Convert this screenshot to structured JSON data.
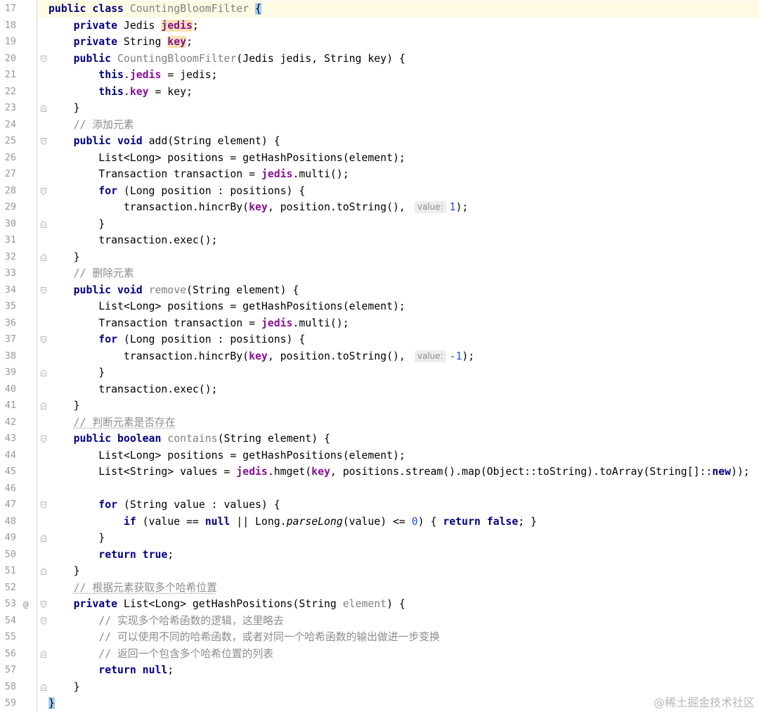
{
  "editor": {
    "lines": [
      {
        "n": "17",
        "current": true,
        "tok": [
          [
            "keyword",
            "public"
          ],
          [
            "plain",
            " "
          ],
          [
            "keyword",
            "class"
          ],
          [
            "plain",
            " "
          ],
          [
            "unused",
            "CountingBloomFilter"
          ],
          [
            "plain",
            " "
          ],
          [
            "brace-match",
            "{"
          ]
        ]
      },
      {
        "n": "18",
        "tok": [
          [
            "plain",
            "    "
          ],
          [
            "keyword",
            "private"
          ],
          [
            "plain",
            " Jedis "
          ],
          [
            "usage-highlight",
            "jedis"
          ],
          [
            "plain",
            ";"
          ]
        ]
      },
      {
        "n": "19",
        "tok": [
          [
            "plain",
            "    "
          ],
          [
            "keyword",
            "private"
          ],
          [
            "plain",
            " String "
          ],
          [
            "usage-highlight",
            "key"
          ],
          [
            "plain",
            ";"
          ]
        ]
      },
      {
        "n": "20",
        "fold": "fold-start-icon",
        "tok": [
          [
            "plain",
            "    "
          ],
          [
            "keyword",
            "public"
          ],
          [
            "plain",
            " "
          ],
          [
            "unused",
            "CountingBloomFilter"
          ],
          [
            "plain",
            "(Jedis jedis, String key) {"
          ]
        ]
      },
      {
        "n": "21",
        "tok": [
          [
            "plain",
            "        "
          ],
          [
            "keyword",
            "this"
          ],
          [
            "plain",
            "."
          ],
          [
            "field",
            "jedis"
          ],
          [
            "plain",
            " = jedis;"
          ]
        ]
      },
      {
        "n": "22",
        "tok": [
          [
            "plain",
            "        "
          ],
          [
            "keyword",
            "this"
          ],
          [
            "plain",
            "."
          ],
          [
            "field",
            "key"
          ],
          [
            "plain",
            " = key;"
          ]
        ]
      },
      {
        "n": "23",
        "fold": "fold-end-icon",
        "tok": [
          [
            "plain",
            "    }"
          ]
        ]
      },
      {
        "n": "24",
        "tok": [
          [
            "plain",
            "    "
          ],
          [
            "comment",
            "// 添加元素"
          ]
        ]
      },
      {
        "n": "25",
        "fold": "fold-start-icon",
        "tok": [
          [
            "plain",
            "    "
          ],
          [
            "keyword",
            "public"
          ],
          [
            "plain",
            " "
          ],
          [
            "keyword",
            "void"
          ],
          [
            "plain",
            " add(String element) {"
          ]
        ]
      },
      {
        "n": "26",
        "tok": [
          [
            "plain",
            "        List<Long> positions = getHashPositions(element);"
          ]
        ]
      },
      {
        "n": "27",
        "tok": [
          [
            "plain",
            "        Transaction transaction = "
          ],
          [
            "field",
            "jedis"
          ],
          [
            "plain",
            ".multi();"
          ]
        ]
      },
      {
        "n": "28",
        "fold": "fold-start-icon",
        "tok": [
          [
            "plain",
            "        "
          ],
          [
            "keyword",
            "for"
          ],
          [
            "plain",
            " (Long position : positions) {"
          ]
        ]
      },
      {
        "n": "29",
        "tok": [
          [
            "plain",
            "            transaction.hincrBy("
          ],
          [
            "field",
            "key"
          ],
          [
            "plain",
            ", position.toString(), "
          ],
          [
            "hint",
            "value:"
          ],
          [
            "number",
            "1"
          ],
          [
            "plain",
            ");"
          ]
        ]
      },
      {
        "n": "30",
        "fold": "fold-end-icon",
        "tok": [
          [
            "plain",
            "        }"
          ]
        ]
      },
      {
        "n": "31",
        "tok": [
          [
            "plain",
            "        transaction.exec();"
          ]
        ]
      },
      {
        "n": "32",
        "fold": "fold-end-icon",
        "tok": [
          [
            "plain",
            "    }"
          ]
        ]
      },
      {
        "n": "33",
        "tok": [
          [
            "plain",
            "    "
          ],
          [
            "comment",
            "// 删除元素"
          ]
        ]
      },
      {
        "n": "34",
        "fold": "fold-start-icon",
        "tok": [
          [
            "plain",
            "    "
          ],
          [
            "keyword",
            "public"
          ],
          [
            "plain",
            " "
          ],
          [
            "keyword",
            "void"
          ],
          [
            "plain",
            " "
          ],
          [
            "unused",
            "remove"
          ],
          [
            "plain",
            "(String element) {"
          ]
        ]
      },
      {
        "n": "35",
        "tok": [
          [
            "plain",
            "        List<Long> positions = getHashPositions(element);"
          ]
        ]
      },
      {
        "n": "36",
        "tok": [
          [
            "plain",
            "        Transaction transaction = "
          ],
          [
            "field",
            "jedis"
          ],
          [
            "plain",
            ".multi();"
          ]
        ]
      },
      {
        "n": "37",
        "fold": "fold-start-icon",
        "tok": [
          [
            "plain",
            "        "
          ],
          [
            "keyword",
            "for"
          ],
          [
            "plain",
            " (Long position : positions) {"
          ]
        ]
      },
      {
        "n": "38",
        "tok": [
          [
            "plain",
            "            transaction.hincrBy("
          ],
          [
            "field",
            "key"
          ],
          [
            "plain",
            ", position.toString(), "
          ],
          [
            "hint",
            "value:"
          ],
          [
            "number",
            "-1"
          ],
          [
            "plain",
            ");"
          ]
        ]
      },
      {
        "n": "39",
        "fold": "fold-end-icon",
        "tok": [
          [
            "plain",
            "        }"
          ]
        ]
      },
      {
        "n": "40",
        "tok": [
          [
            "plain",
            "        transaction.exec();"
          ]
        ]
      },
      {
        "n": "41",
        "fold": "fold-end-icon",
        "tok": [
          [
            "plain",
            "    }"
          ]
        ]
      },
      {
        "n": "42",
        "tok": [
          [
            "plain",
            "    "
          ],
          [
            "comment-flagged",
            "// 判断元素是否存在"
          ]
        ]
      },
      {
        "n": "43",
        "fold": "fold-start-icon",
        "tok": [
          [
            "plain",
            "    "
          ],
          [
            "keyword",
            "public"
          ],
          [
            "plain",
            " "
          ],
          [
            "keyword",
            "boolean"
          ],
          [
            "plain",
            " "
          ],
          [
            "unused",
            "contains"
          ],
          [
            "plain",
            "(String element) {"
          ]
        ]
      },
      {
        "n": "44",
        "tok": [
          [
            "plain",
            "        List<Long> positions = getHashPositions(element);"
          ]
        ]
      },
      {
        "n": "45",
        "tok": [
          [
            "plain",
            "        List<String> values = "
          ],
          [
            "field",
            "jedis"
          ],
          [
            "plain",
            ".hmget("
          ],
          [
            "field",
            "key"
          ],
          [
            "plain",
            ", positions.stream().map(Object::toString).toArray(String[]::"
          ],
          [
            "keyword",
            "new"
          ],
          [
            "plain",
            "));"
          ]
        ]
      },
      {
        "n": "46",
        "tok": []
      },
      {
        "n": "47",
        "fold": "fold-start-icon",
        "tok": [
          [
            "plain",
            "        "
          ],
          [
            "keyword",
            "for"
          ],
          [
            "plain",
            " (String value : values) {"
          ]
        ]
      },
      {
        "n": "48",
        "tok": [
          [
            "plain",
            "            "
          ],
          [
            "keyword",
            "if"
          ],
          [
            "plain",
            " (value == "
          ],
          [
            "keyword",
            "null"
          ],
          [
            "plain",
            " || Long."
          ],
          [
            "static-call",
            "parseLong"
          ],
          [
            "plain",
            "(value) <= "
          ],
          [
            "number",
            "0"
          ],
          [
            "plain",
            ") { "
          ],
          [
            "keyword",
            "return"
          ],
          [
            "plain",
            " "
          ],
          [
            "keyword",
            "false"
          ],
          [
            "plain",
            "; }"
          ]
        ]
      },
      {
        "n": "49",
        "fold": "fold-end-icon",
        "tok": [
          [
            "plain",
            "        }"
          ]
        ]
      },
      {
        "n": "50",
        "tok": [
          [
            "plain",
            "        "
          ],
          [
            "keyword",
            "return"
          ],
          [
            "plain",
            " "
          ],
          [
            "keyword",
            "true"
          ],
          [
            "plain",
            ";"
          ]
        ]
      },
      {
        "n": "51",
        "fold": "fold-end-icon",
        "tok": [
          [
            "plain",
            "    }"
          ]
        ]
      },
      {
        "n": "52",
        "tok": [
          [
            "plain",
            "    "
          ],
          [
            "comment-flagged",
            "// 根据元素获取多个哈希位置"
          ]
        ]
      },
      {
        "n": "53",
        "mark": "@",
        "fold": "fold-start-icon",
        "tok": [
          [
            "plain",
            "    "
          ],
          [
            "keyword",
            "private"
          ],
          [
            "plain",
            " List<Long> getHashPositions(String "
          ],
          [
            "unused",
            "element"
          ],
          [
            "plain",
            ") {"
          ]
        ]
      },
      {
        "n": "54",
        "fold": "fold-start-icon",
        "tok": [
          [
            "plain",
            "        "
          ],
          [
            "comment",
            "// 实现多个哈希函数的逻辑，这里略去"
          ]
        ]
      },
      {
        "n": "55",
        "tok": [
          [
            "plain",
            "        "
          ],
          [
            "comment",
            "// 可以使用不同的哈希函数，或者对同一个哈希函数的输出做进一步变换"
          ]
        ]
      },
      {
        "n": "56",
        "fold": "fold-end-icon",
        "tok": [
          [
            "plain",
            "        "
          ],
          [
            "comment",
            "// 返回一个包含多个哈希位置的列表"
          ]
        ]
      },
      {
        "n": "57",
        "tok": [
          [
            "plain",
            "        "
          ],
          [
            "keyword",
            "return"
          ],
          [
            "plain",
            " "
          ],
          [
            "keyword",
            "null"
          ],
          [
            "plain",
            ";"
          ]
        ]
      },
      {
        "n": "58",
        "fold": "fold-end-icon",
        "tok": [
          [
            "plain",
            "    }"
          ]
        ]
      },
      {
        "n": "59",
        "tok": [
          [
            "brace-match",
            "}"
          ]
        ]
      }
    ]
  },
  "syntax_colors": {
    "keyword": "#000080",
    "field": "#871094",
    "comment": "#8c8c8c",
    "number": "#1750eb",
    "unused": "#808080",
    "hint_text": "#8c8c8c",
    "hint_bg": "#ededed",
    "caret_row_bg": "#fefae3",
    "usage_bg": "#f7e3b2",
    "brace_match_bg": "#9fd0f5",
    "line_number": "#999999"
  },
  "watermark": "@稀土掘金技术社区"
}
